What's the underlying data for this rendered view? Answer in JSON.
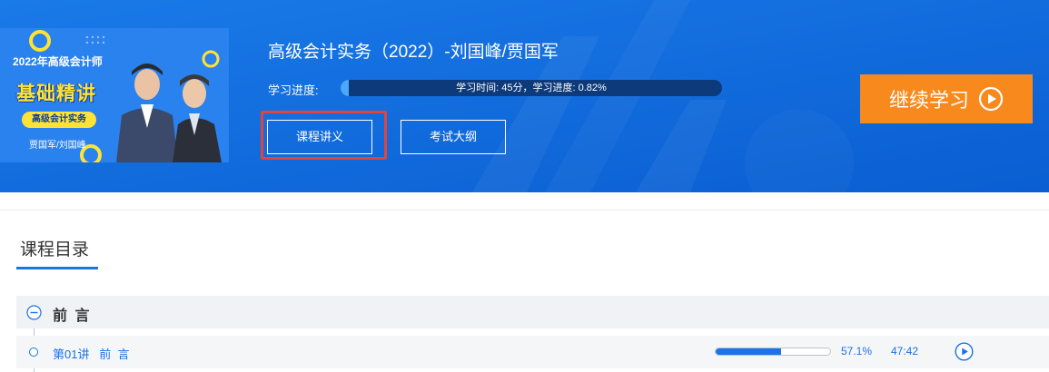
{
  "course": {
    "thumbnail": {
      "line1": "2022年高级会计师",
      "line2": "基础精讲",
      "pill": "高级会计实务",
      "teachers": "贾国军/刘国峰"
    },
    "title": "高级会计实务（2022）-刘国峰/贾国军",
    "progress_label": "学习进度:",
    "progress_text": "学习时间: 45分，学习进度: 0.82%",
    "progress_percent": 0.82,
    "buttons": {
      "handout": "课程讲义",
      "syllabus": "考试大纲",
      "continue": "继续学习"
    }
  },
  "catalog": {
    "tab_label": "课程目录",
    "chapters": [
      {
        "title": "前 言",
        "lessons": [
          {
            "title": "第01讲   前  言",
            "progress": 0.571,
            "progress_text": "57.1%",
            "duration": "47:42"
          }
        ]
      }
    ]
  },
  "colors": {
    "banner": "#0f6fe0",
    "accent": "#1a73e8",
    "continue_button": "#f7891d",
    "highlight": "#e0443c"
  }
}
